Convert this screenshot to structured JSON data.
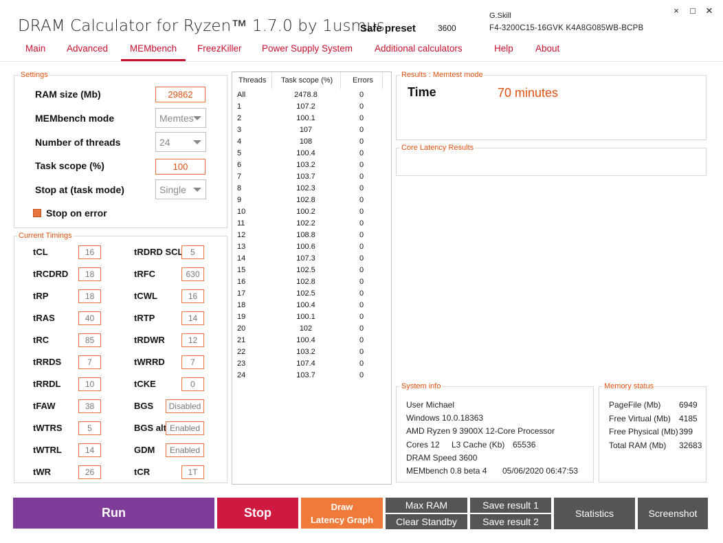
{
  "header": {
    "title": "DRAM Calculator for Ryzen™ 1.7.0 by 1usmus",
    "preset_label": "Safe preset",
    "preset_value": "3600",
    "ram_brand": "G.Skill",
    "ram_part": "F4-3200C15-16GVK  K4A8G085WB-BCPB",
    "window_controls": {
      "minimize": "×",
      "maximize": "□",
      "close": "✕"
    }
  },
  "tabs": [
    {
      "label": "Main"
    },
    {
      "label": "Advanced"
    },
    {
      "label": "MEMbench",
      "active": true
    },
    {
      "label": "FreezKiller"
    },
    {
      "label": "Power Supply System"
    },
    {
      "label": "Additional calculators"
    },
    {
      "label": "Help"
    },
    {
      "label": "About"
    }
  ],
  "settings": {
    "legend": "Settings",
    "ram_size_label": "RAM size (Mb)",
    "ram_size_value": "29862",
    "mode_label": "MEMbench mode",
    "mode_value": "Memtes",
    "threads_label": "Number of threads",
    "threads_value": "24",
    "scope_label": "Task scope (%)",
    "scope_value": "100",
    "stop_at_label": "Stop at (task mode)",
    "stop_at_value": "Single",
    "stop_on_error_label": "Stop on error"
  },
  "timings": {
    "legend": "Current Timings",
    "left": [
      {
        "label": "tCL",
        "value": "16"
      },
      {
        "label": "tRCDRD",
        "value": "18"
      },
      {
        "label": "tRP",
        "value": "18"
      },
      {
        "label": "tRAS",
        "value": "40"
      },
      {
        "label": "tRC",
        "value": "85"
      },
      {
        "label": "tRRDS",
        "value": "7"
      },
      {
        "label": "tRRDL",
        "value": "10"
      },
      {
        "label": "tFAW",
        "value": "38"
      },
      {
        "label": "tWTRS",
        "value": "5"
      },
      {
        "label": "tWTRL",
        "value": "14"
      },
      {
        "label": "tWR",
        "value": "26"
      }
    ],
    "right": [
      {
        "label": "tRDRD SCL",
        "value": "5"
      },
      {
        "label": "tRFC",
        "value": "630"
      },
      {
        "label": "tCWL",
        "value": "16"
      },
      {
        "label": "tRTP",
        "value": "14"
      },
      {
        "label": "tRDWR",
        "value": "12"
      },
      {
        "label": "tWRRD",
        "value": "7"
      },
      {
        "label": "tCKE",
        "value": "0"
      },
      {
        "label": "BGS",
        "value": "Disabled"
      },
      {
        "label": "BGS alt",
        "value": "Enabled"
      },
      {
        "label": "GDM",
        "value": "Enabled"
      },
      {
        "label": "tCR",
        "value": "1T"
      }
    ]
  },
  "threads_table": {
    "headers": [
      "Threads",
      "Task scope (%)",
      "Errors"
    ],
    "rows": [
      [
        "All",
        "2478.8",
        "0"
      ],
      [
        "1",
        "107.2",
        "0"
      ],
      [
        "2",
        "100.1",
        "0"
      ],
      [
        "3",
        "107",
        "0"
      ],
      [
        "4",
        "108",
        "0"
      ],
      [
        "5",
        "100.4",
        "0"
      ],
      [
        "6",
        "103.2",
        "0"
      ],
      [
        "7",
        "103.7",
        "0"
      ],
      [
        "8",
        "102.3",
        "0"
      ],
      [
        "9",
        "102.8",
        "0"
      ],
      [
        "10",
        "100.2",
        "0"
      ],
      [
        "11",
        "102.2",
        "0"
      ],
      [
        "12",
        "108.8",
        "0"
      ],
      [
        "13",
        "100.6",
        "0"
      ],
      [
        "14",
        "107.3",
        "0"
      ],
      [
        "15",
        "102.5",
        "0"
      ],
      [
        "16",
        "102.8",
        "0"
      ],
      [
        "17",
        "102.5",
        "0"
      ],
      [
        "18",
        "100.4",
        "0"
      ],
      [
        "19",
        "100.1",
        "0"
      ],
      [
        "20",
        "102",
        "0"
      ],
      [
        "21",
        "100.4",
        "0"
      ],
      [
        "22",
        "103.2",
        "0"
      ],
      [
        "23",
        "107.4",
        "0"
      ],
      [
        "24",
        "103.7",
        "0"
      ]
    ]
  },
  "results": {
    "legend": "Results : Memtest mode",
    "time_label": "Time",
    "time_value": "70 minutes",
    "latency_legend": "Core Latency Results"
  },
  "system_info": {
    "legend": "System info",
    "user": "User Michael",
    "os": "Windows 10.0.18363",
    "cpu": "AMD Ryzen 9 3900X 12-Core Processor",
    "cores": "Cores 12",
    "l3_label": "L3 Cache (Kb)",
    "l3_value": "65536",
    "dram_speed": "DRAM Speed 3600",
    "membench_version": "MEMbench 0.8 beta 4",
    "timestamp": "05/06/2020 06:47:53"
  },
  "memory_status": {
    "legend": "Memory status",
    "rows": [
      {
        "label": "PageFile (Mb)",
        "value": "6949"
      },
      {
        "label": "Free Virtual (Mb)",
        "value": "4185"
      },
      {
        "label": "Free Physical (Mb)",
        "value": "399"
      },
      {
        "label": "Total RAM (Mb)",
        "value": "32683"
      }
    ]
  },
  "buttons": {
    "run": "Run",
    "stop": "Stop",
    "draw_line1": "Draw",
    "draw_line2": "Latency Graph",
    "max_ram": "Max RAM",
    "clear_standby": "Clear Standby",
    "save1": "Save result 1",
    "save2": "Save result 2",
    "statistics": "Statistics",
    "screenshot": "Screenshot"
  },
  "colors": {
    "accent": "#c8102e",
    "orange": "#e05010",
    "run": "#7e3b98",
    "stop": "#d01940",
    "draw": "#f07a3a",
    "grey": "#555555"
  }
}
